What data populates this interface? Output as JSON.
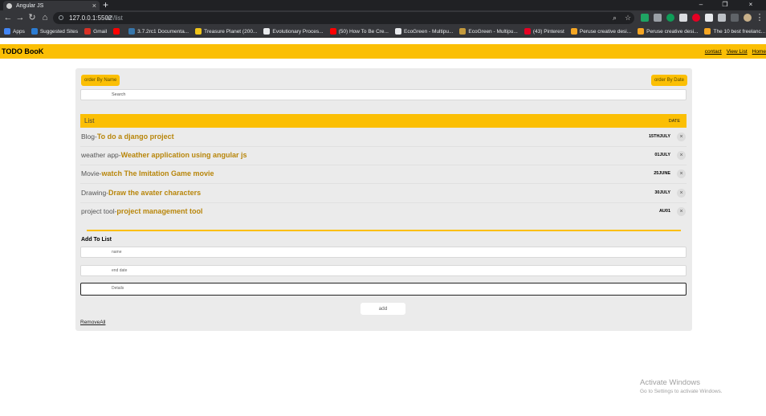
{
  "browser": {
    "tab_title": "Angular JS",
    "url_host": "127.0.0.1:5502",
    "url_path": "/#!/list",
    "bookmarks": [
      {
        "label": "Apps",
        "color": "#4285f4"
      },
      {
        "label": "Suggested Sites",
        "color": "#2b7cd3"
      },
      {
        "label": "Gmail",
        "color": "#d93025"
      },
      {
        "label": "",
        "color": "#ff0000"
      },
      {
        "label": "3.7.2rc1 Documenta...",
        "color": "#3776ab"
      },
      {
        "label": "Treasure Planet (200...",
        "color": "#f0c419"
      },
      {
        "label": "Evolutionary Proces...",
        "color": "#e8eaed"
      },
      {
        "label": "(50) How To Be Cre...",
        "color": "#ff0000"
      },
      {
        "label": "EcoGreen - Multipu...",
        "color": "#e8eaed"
      },
      {
        "label": "EcoGreen - Multipu...",
        "color": "#c49a3c"
      },
      {
        "label": "(43) Pinterest",
        "color": "#e60023"
      },
      {
        "label": "Peruse creative desi...",
        "color": "#f5a623"
      },
      {
        "label": "Peruse creative desi...",
        "color": "#f5a623"
      },
      {
        "label": "The 10 best freelanc...",
        "color": "#f5a623"
      }
    ]
  },
  "app": {
    "brand": "TODO BooK",
    "nav": [
      "contact",
      "View List",
      "Home"
    ],
    "order_by_name": "order By Name",
    "order_by_date": "order By Date",
    "search_placeholder": "Search",
    "list_title": "List",
    "date_header": "DATE",
    "items": [
      {
        "category": "Blog-",
        "task": "To do a django project",
        "date": "15THJULY"
      },
      {
        "category": "weather app-",
        "task": "Weather application using angular js",
        "date": "01JULY"
      },
      {
        "category": "Movie-",
        "task": "watch The Imitation Game movie",
        "date": "25JUNE"
      },
      {
        "category": "Drawing-",
        "task": "Draw the avater characters",
        "date": "30JULY"
      },
      {
        "category": "project tool-",
        "task": "project management tool",
        "date": "AU01"
      }
    ],
    "delete_glyph": "×",
    "add_title": "Add To List",
    "name_placeholder": "name",
    "end_date_placeholder": "end date",
    "details_placeholder": "Details",
    "add_button": "add",
    "remove_all": "RemoveAll"
  },
  "watermark": {
    "title": "Activate Windows",
    "subtitle": "Go to Settings to activate Windows."
  },
  "colors": {
    "accent": "#fbbf04",
    "task_text": "#b8860b",
    "panel": "#ebebeb"
  }
}
